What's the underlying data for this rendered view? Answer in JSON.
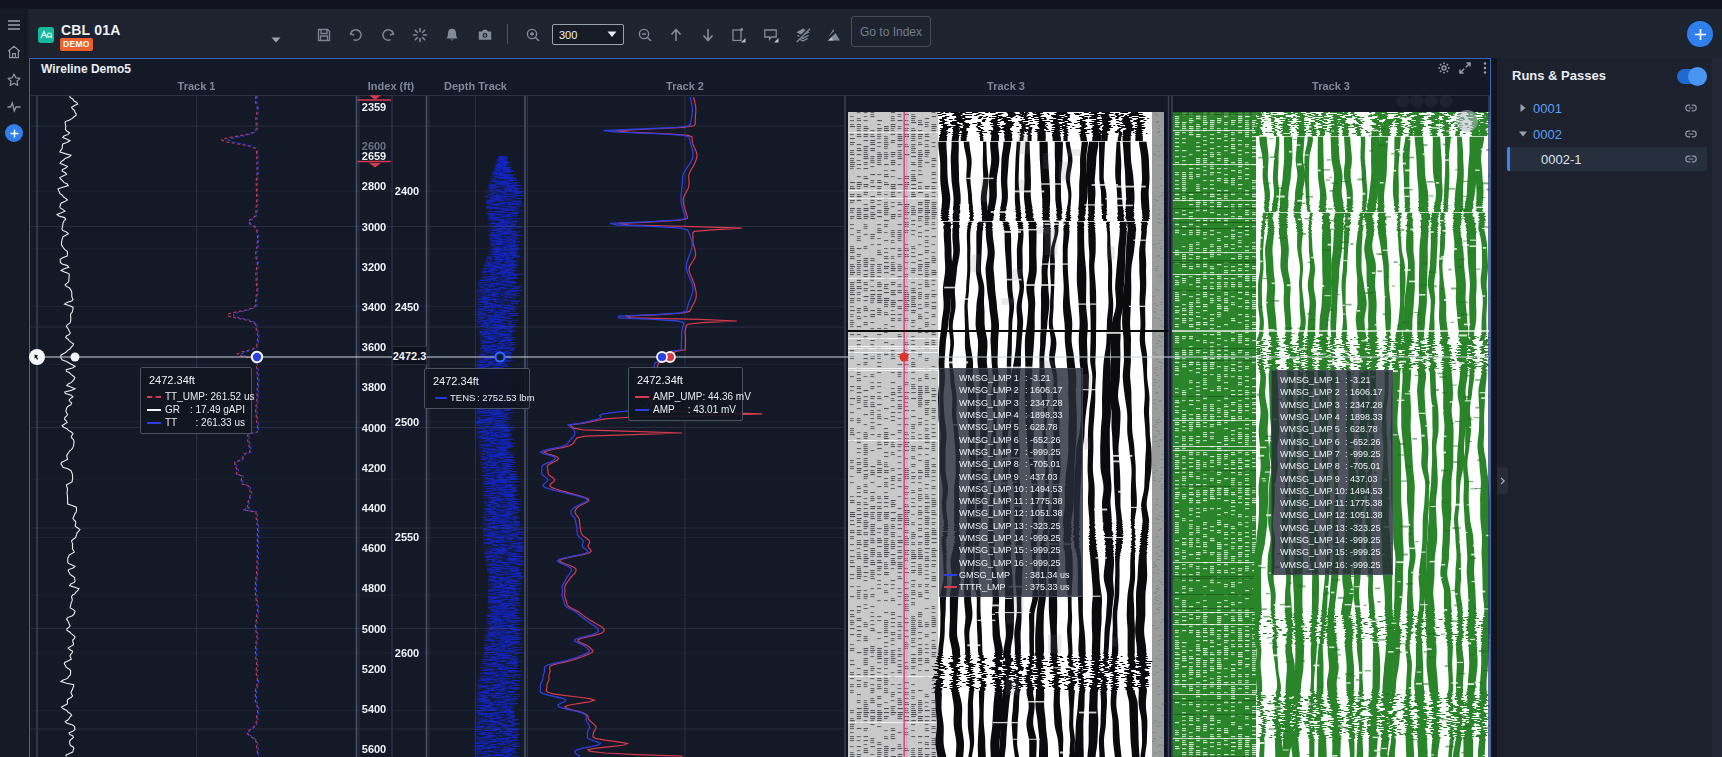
{
  "topbar": {
    "title": "CBL 01A",
    "badge": "DEMO",
    "zoom_value": "300",
    "go_to_index_label": "Go to Index",
    "icons": [
      "save",
      "undo",
      "redo",
      "sparkle",
      "bell",
      "camera",
      "zoom-in",
      "zoom-out",
      "arrow-up",
      "arrow-down",
      "fit-page",
      "comment",
      "layers-off",
      "image-off"
    ],
    "accent_color": "#2f80ed"
  },
  "sidebar": {
    "icons": [
      "menu",
      "home",
      "star",
      "activity",
      "add"
    ]
  },
  "plot": {
    "title": "Wireline Demo5",
    "header_icons": [
      "settings",
      "expand",
      "kebab"
    ],
    "track_headers": [
      "Track 1",
      "Index (ft)",
      "Depth Track",
      "Track 2",
      "Track 3",
      "Track 3"
    ],
    "index_labels": [
      {
        "text": "2359",
        "ft": 2359,
        "style": "boundary"
      },
      {
        "text": "2600",
        "ft": 2600,
        "style": "dim"
      },
      {
        "text": "2659",
        "ft": 2662,
        "style": "boundary"
      },
      {
        "text": "2800",
        "ft": 2800
      },
      {
        "text": "3000",
        "ft": 3000
      },
      {
        "text": "3200",
        "ft": 3200
      },
      {
        "text": "3400",
        "ft": 3400
      },
      {
        "text": "3600",
        "ft": 3600
      },
      {
        "text": "3800",
        "ft": 3800
      },
      {
        "text": "4000",
        "ft": 4000
      },
      {
        "text": "4200",
        "ft": 4200
      },
      {
        "text": "4400",
        "ft": 4400
      },
      {
        "text": "4600",
        "ft": 4600
      },
      {
        "text": "4800",
        "ft": 4800
      },
      {
        "text": "5000",
        "ft": 5000
      },
      {
        "text": "5200",
        "ft": 5200
      },
      {
        "text": "5400",
        "ft": 5400
      },
      {
        "text": "5600",
        "ft": 5600
      }
    ],
    "depth_labels": [
      {
        "text": "2400",
        "d": 2400
      },
      {
        "text": "2450",
        "d": 2450
      },
      {
        "text": "2500",
        "d": 2500
      },
      {
        "text": "2550",
        "d": 2550
      },
      {
        "text": "2600",
        "d": 2600
      }
    ],
    "crosshair_label": "2472.3",
    "boundaries": [
      "2359",
      "2659"
    ]
  },
  "tooltips": {
    "track1": {
      "title": "2472.34ft",
      "rows": [
        {
          "name": "TT_UMP",
          "value": ": 261.52 us",
          "swatch": "#d63a4d",
          "dashed": true
        },
        {
          "name": "GR",
          "value": ": 17.49 gAPI",
          "swatch": "#f2f4f6"
        },
        {
          "name": "TT",
          "value": ": 261.33 us",
          "swatch": "#2b3fe0"
        }
      ]
    },
    "depth_track": {
      "title": "2472.34ft",
      "rows": [
        {
          "name": "TENS",
          "value": ": 2752.53 lbm",
          "swatch": "#2036d6"
        }
      ]
    },
    "track2": {
      "title": "2472.34ft",
      "rows": [
        {
          "name": "AMP_UMP",
          "value": ": 44.36 mV",
          "swatch": "#d63a4d"
        },
        {
          "name": "AMP",
          "value": ": 43.01 mV",
          "swatch": "#2b3fe0"
        }
      ]
    },
    "vdl_black": {
      "rows": [
        {
          "name": "WMSG_LMP 1",
          "value": ": -3.21"
        },
        {
          "name": "WMSG_LMP 2",
          "value": ": 1606.17"
        },
        {
          "name": "WMSG_LMP 3",
          "value": ": 2347.28"
        },
        {
          "name": "WMSG_LMP 4",
          "value": ": 1898.33"
        },
        {
          "name": "WMSG_LMP 5",
          "value": ": 628.78"
        },
        {
          "name": "WMSG_LMP 6",
          "value": ": -652.26"
        },
        {
          "name": "WMSG_LMP 7",
          "value": ": -999.25"
        },
        {
          "name": "WMSG_LMP 8",
          "value": ": -705.01"
        },
        {
          "name": "WMSG_LMP 9",
          "value": ": 437.03"
        },
        {
          "name": "WMSG_LMP 10",
          "value": ": 1494.53"
        },
        {
          "name": "WMSG_LMP 11",
          "value": ": 1775.38"
        },
        {
          "name": "WMSG_LMP 12",
          "value": ": 1051.38"
        },
        {
          "name": "WMSG_LMP 13",
          "value": ": -323.25"
        },
        {
          "name": "WMSG_LMP 14",
          "value": ": -999.25"
        },
        {
          "name": "WMSG_LMP 15",
          "value": ": -999.25"
        },
        {
          "name": "WMSG_LMP 16",
          "value": ": -999.25"
        },
        {
          "name": "GMSG_LMP",
          "value": ": 381.34 us",
          "swatch": "#2b3fe0"
        },
        {
          "name": "TTTR_LMP",
          "value": ": 375.33 us",
          "swatch": "#d63a4d"
        }
      ]
    },
    "vdl_green": {
      "rows": [
        {
          "name": "WMSG_LMP 1",
          "value": ": -3.21"
        },
        {
          "name": "WMSG_LMP 2",
          "value": ": 1606.17"
        },
        {
          "name": "WMSG_LMP 3",
          "value": ": 2347.28"
        },
        {
          "name": "WMSG_LMP 4",
          "value": ": 1898.33"
        },
        {
          "name": "WMSG_LMP 5",
          "value": ": 628.78"
        },
        {
          "name": "WMSG_LMP 6",
          "value": ": -652.26"
        },
        {
          "name": "WMSG_LMP 7",
          "value": ": -999.25"
        },
        {
          "name": "WMSG_LMP 8",
          "value": ": -705.01"
        },
        {
          "name": "WMSG_LMP 9",
          "value": ": 437.03"
        },
        {
          "name": "WMSG_LMP 10",
          "value": ": 1494.53"
        },
        {
          "name": "WMSG_LMP 11",
          "value": ": 1775.38"
        },
        {
          "name": "WMSG_LMP 12",
          "value": ": 1051.38"
        },
        {
          "name": "WMSG_LMP 13",
          "value": ": -323.25"
        },
        {
          "name": "WMSG_LMP 14",
          "value": ": -999.25"
        },
        {
          "name": "WMSG_LMP 15",
          "value": ": -999.25"
        },
        {
          "name": "WMSG_LMP 16",
          "value": ": -999.25"
        }
      ]
    }
  },
  "right_panel": {
    "title": "Runs & Passes",
    "toggle_on": true,
    "items": [
      {
        "label": "0001",
        "caret": "right",
        "link": true,
        "children": []
      },
      {
        "label": "0002",
        "caret": "down",
        "link": true,
        "children": [
          {
            "label": "0002-1",
            "selected": true,
            "link": true
          }
        ]
      }
    ]
  },
  "colors": {
    "accent": "#2f80ed",
    "badge": "#e8612c",
    "logo": "#14b89c",
    "red_curve": "#d63a4d",
    "blue_curve": "#2b3fe0",
    "green_vdl": "#2e8b2e",
    "panel_border": "#3767bd",
    "link_blue": "#5d9ff3"
  }
}
